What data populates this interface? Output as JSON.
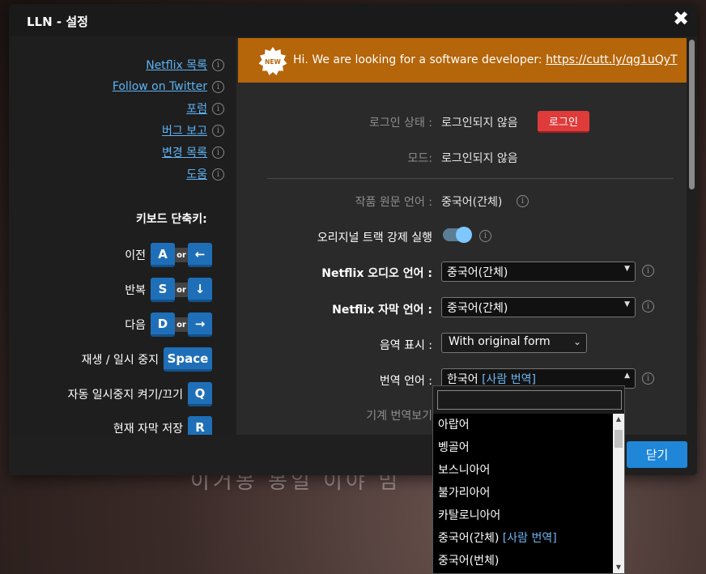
{
  "window": {
    "title": "LLN - 설정",
    "close_glyph": "✖"
  },
  "sidebar": {
    "links": [
      {
        "label": "Netflix 목록"
      },
      {
        "label": "Follow on Twitter"
      },
      {
        "label": "포럼"
      },
      {
        "label": "버그 보고"
      },
      {
        "label": "변경 목록"
      },
      {
        "label": "도움"
      }
    ],
    "info_glyph": "i",
    "shortcuts_title": "키보드 단축키:",
    "or_label": "or",
    "shortcuts": [
      {
        "label": "이전",
        "key1": "A",
        "key2": "←"
      },
      {
        "label": "반복",
        "key1": "S",
        "key2": "↓"
      },
      {
        "label": "다음",
        "key1": "D",
        "key2": "→"
      },
      {
        "label": "재생 / 일시 중지",
        "key1": "Space"
      },
      {
        "label": "자동 일시중지 켜기/끄기",
        "key1": "Q"
      },
      {
        "label": "현재 자막 저장",
        "key1": "R"
      }
    ]
  },
  "banner": {
    "badge": "NEW",
    "text": "Hi. We are looking for a software developer: ",
    "link": "https://cutt.ly/qg1uQyT",
    "color": "#b5650a"
  },
  "settings": {
    "login_status_label": "로그인 상태 :",
    "login_status_value": "로그인되지 않음",
    "login_button": "로그인",
    "mode_label": "모드:",
    "mode_value": "로그인되지 않음",
    "original_lang_label": "작품 원문 언어 :",
    "original_lang_value": "중국어(간체)",
    "force_track_label": "오리지널 트랙 강제 실행",
    "force_track_on": true,
    "audio_label": "Netflix 오디오 언어 :",
    "audio_value": "중국어(간체)",
    "subtitle_label": "Netflix 자막 언어 :",
    "subtitle_value": "중국어(간체)",
    "phonetic_label": "음역 표시 :",
    "phonetic_value": "With original form",
    "translation_label": "번역 언어 :",
    "translation_value": "한국어",
    "translation_tag": "[사람 번역]",
    "machine_label": "기계 번역보기"
  },
  "dropdown": {
    "search_value": "",
    "items": [
      {
        "label": "아랍어",
        "tag": ""
      },
      {
        "label": "벵골어",
        "tag": ""
      },
      {
        "label": "보스니아어",
        "tag": ""
      },
      {
        "label": "불가리아어",
        "tag": ""
      },
      {
        "label": "카탈로니아어",
        "tag": ""
      },
      {
        "label": "중국어(간체)",
        "tag": "[사람 번역]"
      },
      {
        "label": "중국어(번체)",
        "tag": ""
      }
    ]
  },
  "footer": {
    "close_button": "닫기"
  },
  "background_subtitle": "이거봉 봉일 이야 밈"
}
